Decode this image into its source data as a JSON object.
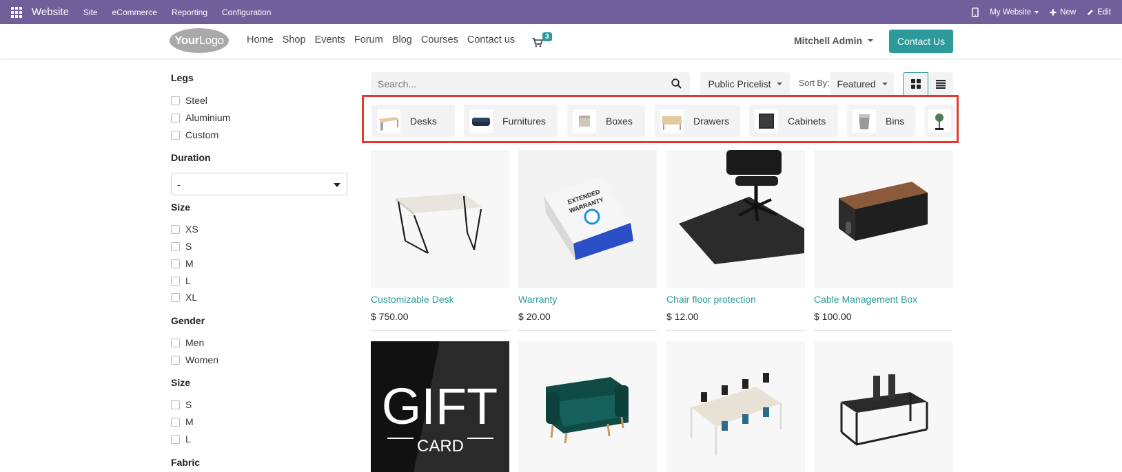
{
  "admin_bar": {
    "app_name": "Website",
    "menus": [
      "Site",
      "eCommerce",
      "Reporting",
      "Configuration"
    ],
    "my_website": "My Website",
    "new": "New",
    "edit": "Edit"
  },
  "header": {
    "logo_bold": "Your",
    "logo_rest": "Logo",
    "nav": [
      "Home",
      "Shop",
      "Events",
      "Forum",
      "Blog",
      "Courses",
      "Contact us"
    ],
    "cart_count": "3",
    "user": "Mitchell Admin",
    "contact_button": "Contact Us"
  },
  "filters": {
    "legs_title": "Legs",
    "legs": [
      "Steel",
      "Aluminium",
      "Custom"
    ],
    "duration_title": "Duration",
    "duration_value": "-",
    "size_title": "Size",
    "sizes": [
      "XS",
      "S",
      "M",
      "L",
      "XL"
    ],
    "gender_title": "Gender",
    "genders": [
      "Men",
      "Women"
    ],
    "size2_title": "Size",
    "sizes2": [
      "S",
      "M",
      "L"
    ],
    "fabric_title": "Fabric"
  },
  "toolbar": {
    "search_placeholder": "Search...",
    "pricelist": "Public Pricelist",
    "sort_label": "Sort By:",
    "sort_value": "Featured"
  },
  "categories": [
    "Desks",
    "Furnitures",
    "Boxes",
    "Drawers",
    "Cabinets",
    "Bins"
  ],
  "products": [
    {
      "name": "Customizable Desk",
      "price": "$ 750.00"
    },
    {
      "name": "Warranty",
      "price": "$ 20.00"
    },
    {
      "name": "Chair floor protection",
      "price": "$ 12.00"
    },
    {
      "name": "Cable Management Box",
      "price": "$ 100.00"
    }
  ],
  "gift_card": {
    "line1": "GIFT",
    "line2": "CARD"
  },
  "warranty_box": {
    "line1": "EXTENDED",
    "line2": "WARRANTY"
  },
  "colors": {
    "admin_bar": "#715f9c",
    "accent": "#2c9a9a",
    "highlight": "#e2382d"
  }
}
